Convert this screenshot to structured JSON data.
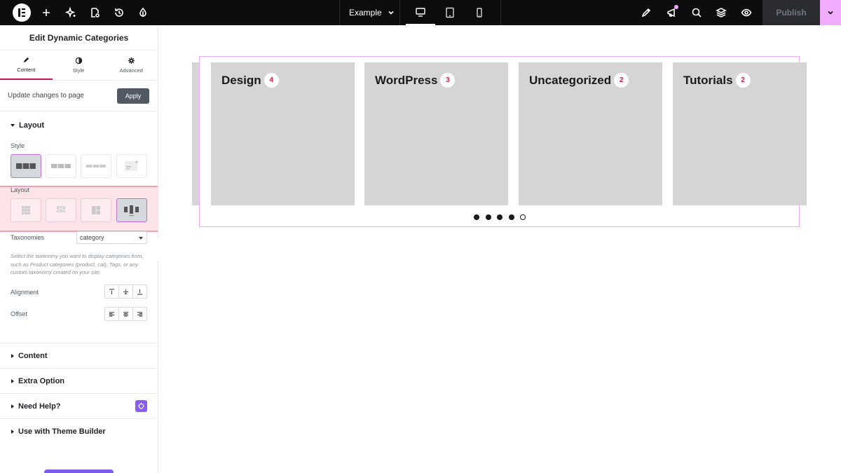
{
  "topbar": {
    "document_title": "Example",
    "publish_label": "Publish",
    "icons": [
      "elementor-logo",
      "add-icon",
      "ai-sparkle-icon",
      "page-settings-icon",
      "history-icon",
      "theme-style-icon",
      "site-settings-icon",
      "notifications-icon",
      "search-icon",
      "structure-icon",
      "preview-icon"
    ],
    "devices": [
      "desktop",
      "tablet",
      "mobile"
    ],
    "active_device": "desktop"
  },
  "panel": {
    "title": "Edit Dynamic Categories",
    "tabs": [
      {
        "label": "Content",
        "icon": "pencil-icon",
        "active": true
      },
      {
        "label": "Style",
        "icon": "half-circle-icon",
        "active": false
      },
      {
        "label": "Advanced",
        "icon": "gear-icon",
        "active": false
      }
    ],
    "update_text": "Update changes to page",
    "apply_label": "Apply",
    "layout_section": {
      "title": "Layout",
      "style_label": "Style",
      "layout_label": "Layout",
      "taxonomies_label": "Taxonomies",
      "taxonomies_value": "category",
      "help_text": "Select the taxonomy you want to display categories from, such as Product categories (product_cat), Tags, or any custom taxonomy created on your site.",
      "alignment_label": "Alignment",
      "offset_label": "Offset"
    },
    "accordions": [
      {
        "label": "Content"
      },
      {
        "label": "Extra Option"
      },
      {
        "label": "Need Help?"
      },
      {
        "label": "Use with Theme Builder"
      }
    ]
  },
  "canvas": {
    "cards": [
      {
        "title": "Design",
        "count": "4"
      },
      {
        "title": "WordPress",
        "count": "3"
      },
      {
        "title": "Uncategorized",
        "count": "2"
      },
      {
        "title": "Tutorials",
        "count": "2"
      }
    ],
    "pagination": {
      "total": 5,
      "active_index": 4
    }
  },
  "colors": {
    "topbar_bg": "#0c0d0e",
    "accent_pink": "#f0abfc",
    "count_red": "#e0173a",
    "card_bg": "#d5d5d5",
    "tab_active": "#c2185b"
  }
}
